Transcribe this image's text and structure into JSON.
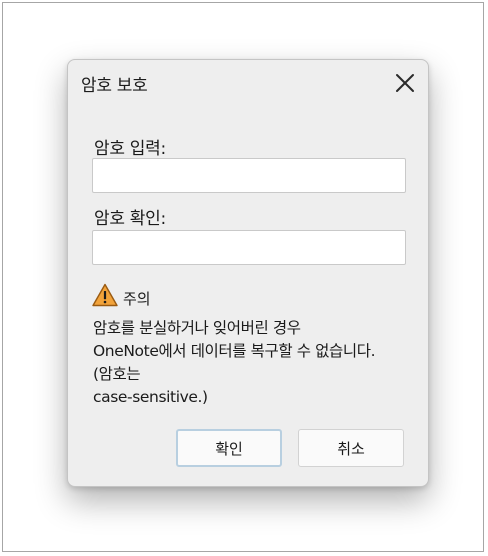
{
  "dialog": {
    "title": "암호 보호"
  },
  "fields": {
    "password_label": "암호 입력:",
    "password_value": "",
    "confirm_label": "암호 확인:",
    "confirm_value": ""
  },
  "warning": {
    "icon": "warning-triangle-icon",
    "label": "주의",
    "line1": "암호를 분실하거나 잊어버린 경우",
    "line2": "OneNote에서 데이터를 복구할 수 없습니다.",
    "line3": "(암호는",
    "line4": "case-sensitive.)"
  },
  "buttons": {
    "ok_label": "확인",
    "cancel_label": "취소"
  },
  "colors": {
    "dialog_background": "#eeeeee",
    "warning_fill": "#f2a33a",
    "default_button_border": "#b8cfe0"
  }
}
